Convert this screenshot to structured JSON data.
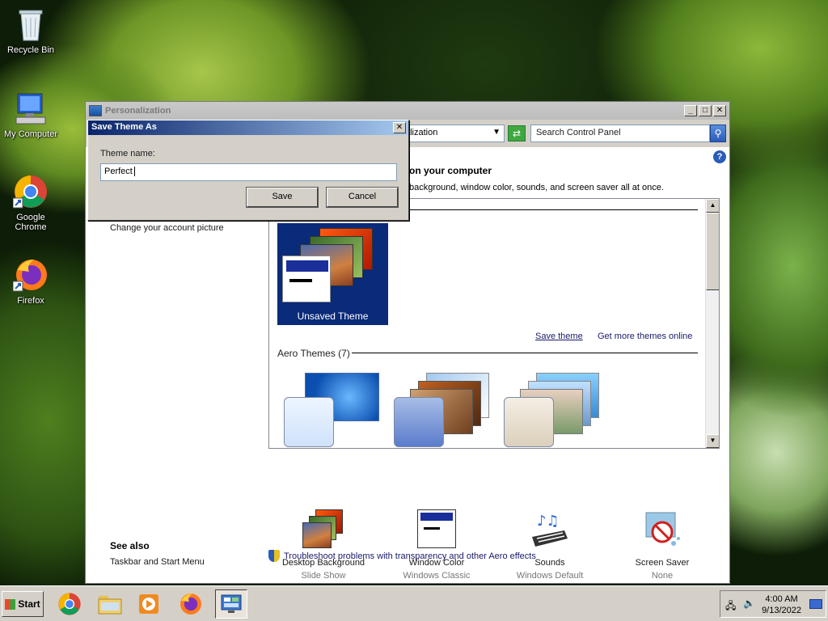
{
  "desktop": {
    "icons": [
      {
        "label": "Recycle Bin",
        "icon": "recycle-bin-icon"
      },
      {
        "label": "My Computer",
        "icon": "computer-icon"
      },
      {
        "label": "Google Chrome",
        "icon": "chrome-icon"
      },
      {
        "label": "Firefox",
        "icon": "firefox-icon"
      }
    ]
  },
  "window": {
    "title": "Personalization",
    "address_text": "alization",
    "search_placeholder": "Search Control Panel",
    "heading": "on your computer",
    "description": "background, window color, sounds, and screen saver all at once.",
    "left_link": "Change your account picture",
    "themes": {
      "unsaved_label": "Unsaved Theme",
      "save_theme": "Save theme",
      "get_more": "Get more themes online",
      "aero_title": "Aero Themes (7)"
    },
    "bottom": [
      {
        "title": "Desktop Background",
        "value": "Slide Show"
      },
      {
        "title": "Window Color",
        "value": "Windows Classic"
      },
      {
        "title": "Sounds",
        "value": "Windows Default"
      },
      {
        "title": "Screen Saver",
        "value": "None"
      }
    ],
    "see_also": "See also",
    "see_also_link": "Taskbar and Start Menu",
    "troubleshoot": "Troubleshoot problems with transparency and other Aero effects"
  },
  "dialog": {
    "title": "Save Theme As",
    "label": "Theme name:",
    "value": "Perfect",
    "save": "Save",
    "cancel": "Cancel"
  },
  "taskbar": {
    "start": "Start",
    "time": "4:00 AM",
    "date": "9/13/2022"
  }
}
